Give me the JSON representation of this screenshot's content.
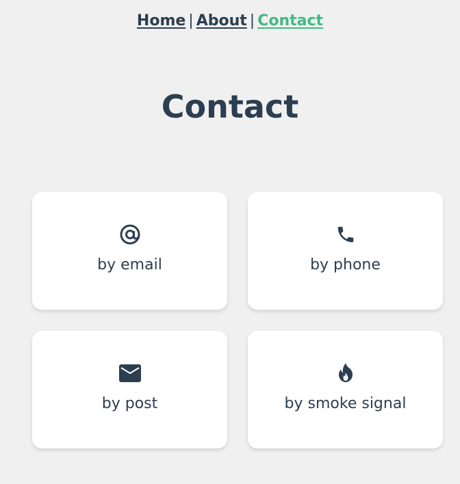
{
  "nav": {
    "items": [
      {
        "label": "Home",
        "active": false
      },
      {
        "label": "About",
        "active": false
      },
      {
        "label": "Contact",
        "active": true
      }
    ],
    "separator": "|"
  },
  "page": {
    "title": "Contact"
  },
  "cards": [
    {
      "icon": "at-sign-icon",
      "label": "by email"
    },
    {
      "icon": "phone-icon",
      "label": "by phone"
    },
    {
      "icon": "envelope-icon",
      "label": "by post"
    },
    {
      "icon": "fire-icon",
      "label": "by smoke signal"
    }
  ],
  "colors": {
    "text": "#2c3e50",
    "accent": "#42b983",
    "background": "#f0f0f0",
    "card": "#ffffff"
  }
}
